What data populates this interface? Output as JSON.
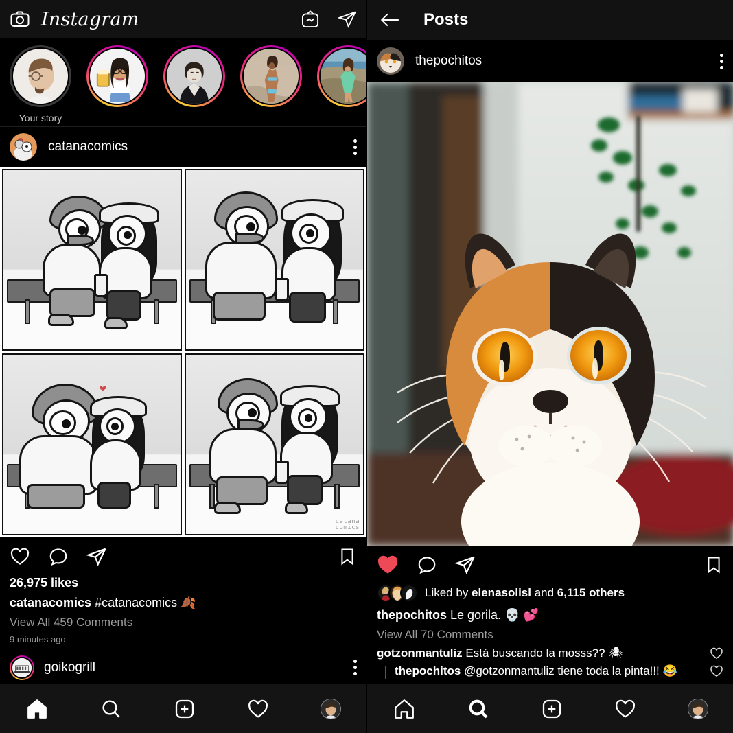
{
  "app": {
    "name": "Instagram"
  },
  "left": {
    "appbar": {
      "logo": "Instagram",
      "camera_icon": "camera-icon",
      "igtv_icon": "igtv-icon",
      "messenger_icon": "messenger-icon"
    },
    "stories": [
      {
        "label": "Your story",
        "own": true,
        "name": "story-your-story"
      },
      {
        "label": "",
        "own": false,
        "name": "story-2"
      },
      {
        "label": "",
        "own": false,
        "name": "story-3"
      },
      {
        "label": "",
        "own": false,
        "name": "story-4"
      },
      {
        "label": "",
        "own": false,
        "name": "story-5"
      }
    ],
    "post": {
      "username": "catanacomics",
      "likes": "26,975 likes",
      "caption_user": "catanacomics",
      "caption_text": " #catanacomics 🍂",
      "view_comments": "View All 459 Comments",
      "timestamp": "9 minutes ago",
      "watermark_line1": "catana",
      "watermark_line2": "comics",
      "liked": false
    },
    "next_post": {
      "username": "goikogrill"
    },
    "nav": {
      "home": "home-icon",
      "search": "search-icon",
      "add": "add-post-icon",
      "activity": "heart-icon",
      "profile": "profile-avatar",
      "active": "home"
    }
  },
  "right": {
    "topbar": {
      "back": "back-arrow-icon",
      "title": "Posts"
    },
    "post": {
      "username": "thepochitos",
      "liked": true,
      "liked_by_prefix": "Liked by ",
      "liked_by_user": "elenasolisl",
      "liked_by_mid": " and ",
      "liked_by_count": "6,115 others",
      "caption_user": "thepochitos",
      "caption_text": " Le gorila. 💀 💕",
      "view_comments": "View All 70 Comments",
      "comments": [
        {
          "user": "gotzonmantuliz",
          "text": " Está buscando la mosss?? 🕷",
          "reply": false
        },
        {
          "user": "thepochitos",
          "text": " @gotzonmantuliz tiene toda la pinta!!! 😂",
          "reply": true
        }
      ]
    },
    "nav": {
      "home": "home-icon",
      "search": "search-icon",
      "add": "add-post-icon",
      "activity": "heart-icon",
      "profile": "profile-avatar",
      "active": "search"
    }
  },
  "colors": {
    "bg": "#000000",
    "bar": "#121212",
    "text": "#ffffff",
    "muted": "#9b9b9b",
    "like_red": "#ed4956",
    "ring_a": "#f9ce34",
    "ring_b": "#ee2a7b",
    "ring_c": "#b900b4"
  }
}
